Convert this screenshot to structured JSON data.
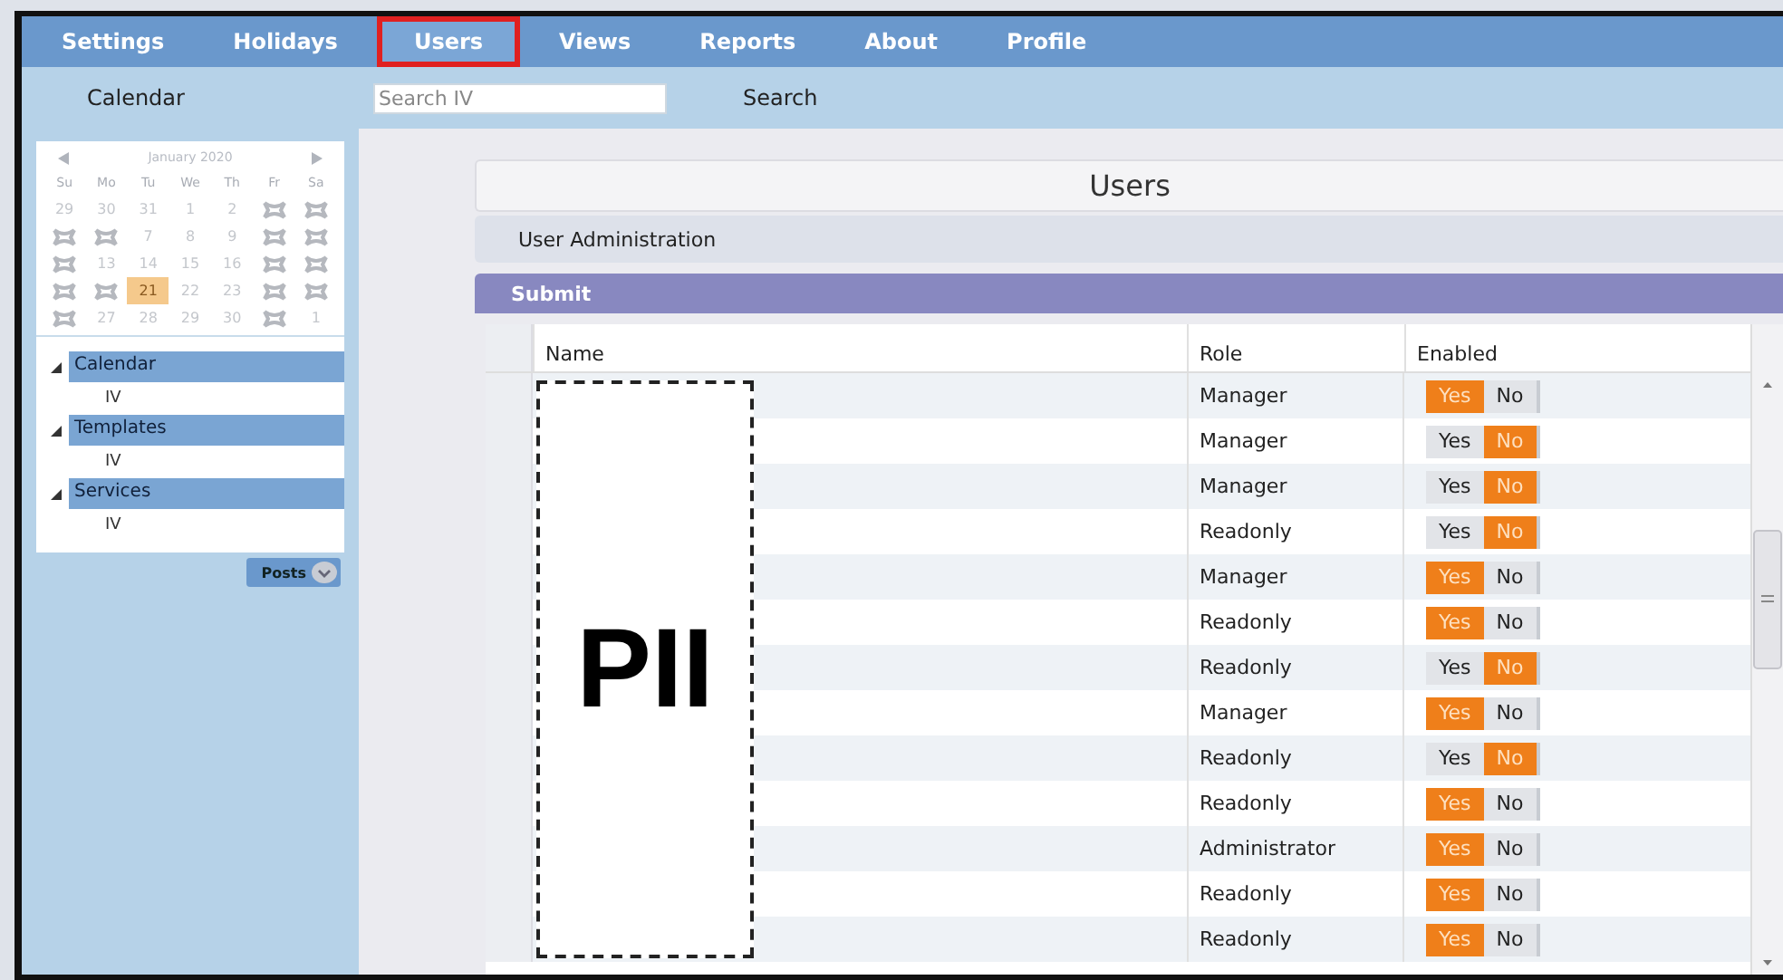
{
  "nav": {
    "items": [
      {
        "label": "Settings",
        "selected": false
      },
      {
        "label": "Holidays",
        "selected": false
      },
      {
        "label": "Users",
        "selected": true
      },
      {
        "label": "Views",
        "selected": false
      },
      {
        "label": "Reports",
        "selected": false
      },
      {
        "label": "About",
        "selected": false
      },
      {
        "label": "Profile",
        "selected": false
      }
    ]
  },
  "toolbar": {
    "calendar_link": "Calendar",
    "search": {
      "placeholder": "Search IV"
    },
    "search_button": "Search"
  },
  "calendar": {
    "month": "January 2020",
    "weekdays": [
      "Su",
      "Mo",
      "Tu",
      "We",
      "Th",
      "Fr",
      "Sa"
    ],
    "days": [
      {
        "text": "29",
        "blocked": false,
        "selected": false
      },
      {
        "text": "30",
        "blocked": false,
        "selected": false
      },
      {
        "text": "31",
        "blocked": false,
        "selected": false
      },
      {
        "text": "1",
        "blocked": false,
        "selected": false
      },
      {
        "text": "2",
        "blocked": false,
        "selected": false
      },
      {
        "blocked": true,
        "selected": false
      },
      {
        "blocked": true,
        "selected": false
      },
      {
        "blocked": true,
        "selected": false
      },
      {
        "blocked": true,
        "selected": false
      },
      {
        "text": "7",
        "blocked": false,
        "selected": false
      },
      {
        "text": "8",
        "blocked": false,
        "selected": false
      },
      {
        "text": "9",
        "blocked": false,
        "selected": false
      },
      {
        "blocked": true,
        "selected": false
      },
      {
        "blocked": true,
        "selected": false
      },
      {
        "blocked": true,
        "selected": false
      },
      {
        "text": "13",
        "blocked": false,
        "selected": false
      },
      {
        "text": "14",
        "blocked": false,
        "selected": false
      },
      {
        "text": "15",
        "blocked": false,
        "selected": false
      },
      {
        "text": "16",
        "blocked": false,
        "selected": false
      },
      {
        "blocked": true,
        "selected": false
      },
      {
        "blocked": true,
        "selected": false
      },
      {
        "blocked": true,
        "selected": false
      },
      {
        "blocked": true,
        "selected": false
      },
      {
        "text": "21",
        "blocked": false,
        "selected": true
      },
      {
        "text": "22",
        "blocked": false,
        "selected": false
      },
      {
        "text": "23",
        "blocked": false,
        "selected": false
      },
      {
        "blocked": true,
        "selected": false
      },
      {
        "blocked": true,
        "selected": false
      },
      {
        "blocked": true,
        "selected": false
      },
      {
        "text": "27",
        "blocked": false,
        "selected": false
      },
      {
        "text": "28",
        "blocked": false,
        "selected": false
      },
      {
        "text": "29",
        "blocked": false,
        "selected": false
      },
      {
        "text": "30",
        "blocked": false,
        "selected": false
      },
      {
        "blocked": true,
        "selected": false
      },
      {
        "text": "1",
        "blocked": false,
        "selected": false
      }
    ]
  },
  "tree": [
    {
      "label": "Calendar",
      "expanded": true,
      "children": [
        {
          "label": "IV"
        }
      ]
    },
    {
      "label": "Templates",
      "expanded": true,
      "children": [
        {
          "label": "IV"
        }
      ]
    },
    {
      "label": "Services",
      "expanded": true,
      "children": [
        {
          "label": "IV"
        }
      ]
    }
  ],
  "posts_button": "Posts",
  "main": {
    "title": "Users",
    "section": "User Administration",
    "submit": "Submit",
    "columns": [
      "Name",
      "Role",
      "Enabled"
    ],
    "rows": [
      {
        "role": "Manager",
        "yes": "Yes",
        "no": "No",
        "enabled": true
      },
      {
        "role": "Manager",
        "yes": "Yes",
        "no": "No",
        "enabled": false
      },
      {
        "role": "Manager",
        "yes": "Yes",
        "no": "No",
        "enabled": false
      },
      {
        "role": "Readonly",
        "yes": "Yes",
        "no": "No",
        "enabled": false
      },
      {
        "role": "Manager",
        "yes": "Yes",
        "no": "No",
        "enabled": true
      },
      {
        "role": "Readonly",
        "yes": "Yes",
        "no": "No",
        "enabled": true
      },
      {
        "role": "Readonly",
        "yes": "Yes",
        "no": "No",
        "enabled": false
      },
      {
        "role": "Manager",
        "yes": "Yes",
        "no": "No",
        "enabled": true
      },
      {
        "role": "Readonly",
        "yes": "Yes",
        "no": "No",
        "enabled": false
      },
      {
        "role": "Readonly",
        "yes": "Yes",
        "no": "No",
        "enabled": true
      },
      {
        "role": "Administrator",
        "yes": "Yes",
        "no": "No",
        "enabled": true
      },
      {
        "role": "Readonly",
        "yes": "Yes",
        "no": "No",
        "enabled": true
      },
      {
        "role": "Readonly",
        "yes": "Yes",
        "no": "No",
        "enabled": true
      }
    ],
    "redaction": {
      "label": "PII"
    }
  }
}
